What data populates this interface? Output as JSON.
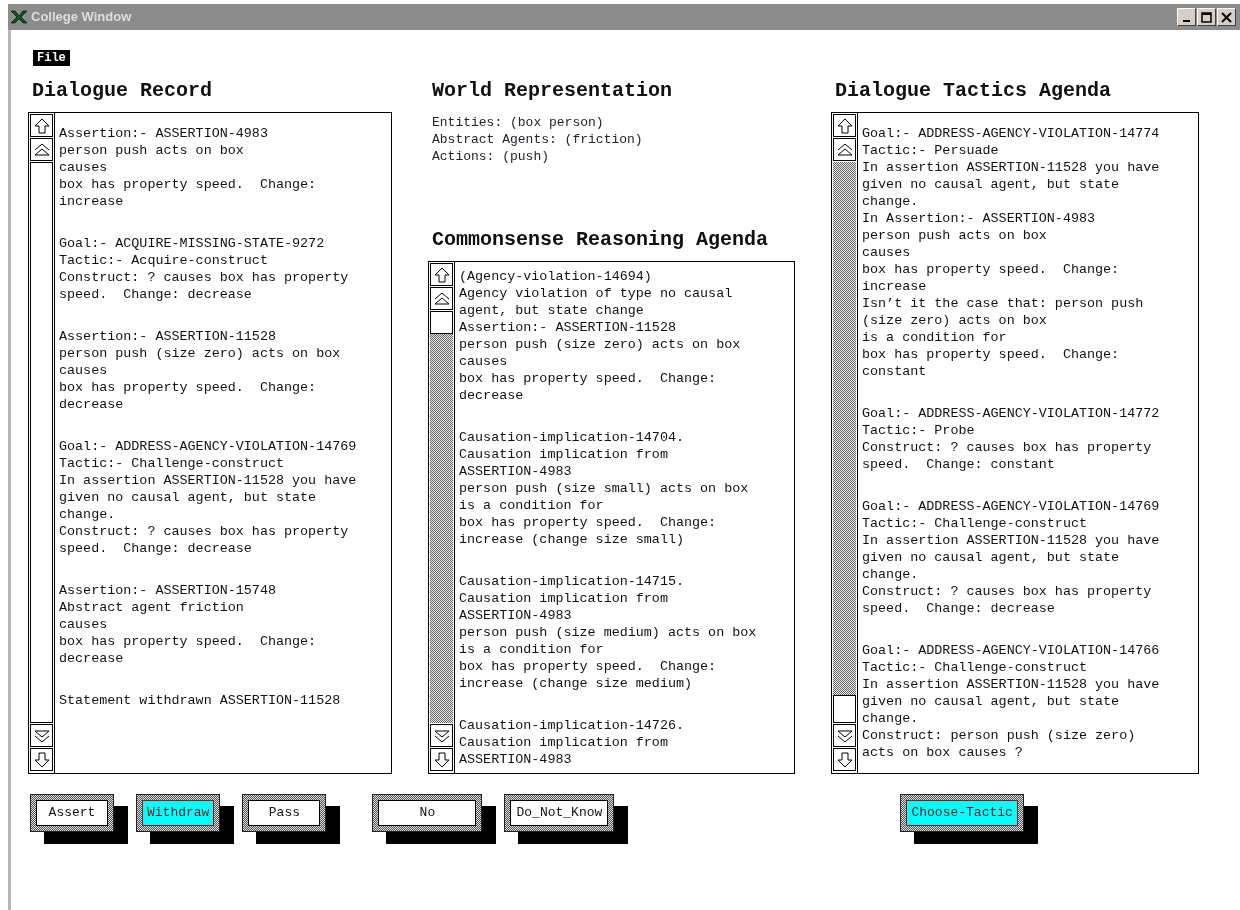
{
  "window": {
    "title": "College Window"
  },
  "menu": [
    {
      "label": "File"
    }
  ],
  "dialogue_record": {
    "heading": "Dialogue Record",
    "entries": [
      [
        "Assertion:- ASSERTION-4983",
        "person push acts on box",
        "causes",
        "box has property speed.  Change:",
        "increase"
      ],
      [
        "Goal:- ACQUIRE-MISSING-STATE-9272",
        "Tactic:- Acquire-construct",
        "Construct: ? causes box has property",
        "speed.  Change: decrease"
      ],
      [
        "Assertion:- ASSERTION-11528",
        "person push (size zero) acts on box",
        "causes",
        "box has property speed.  Change:",
        "decrease"
      ],
      [
        "Goal:- ADDRESS-AGENCY-VIOLATION-14769",
        "Tactic:- Challenge-construct",
        "In assertion ASSERTION-11528 you have",
        "given no causal agent, but state",
        "change.",
        "Construct: ? causes box has property",
        "speed.  Change: decrease"
      ],
      [
        "Assertion:- ASSERTION-15748",
        "Abstract agent friction",
        "causes",
        "box has property speed.  Change:",
        "decrease"
      ],
      [
        "Statement withdrawn ASSERTION-11528"
      ]
    ]
  },
  "world_representation": {
    "heading": "World Representation",
    "lines": [
      "Entities: (box person)",
      "Abstract Agents: (friction)",
      "Actions: (push)"
    ]
  },
  "commonsense_reasoning_agenda": {
    "heading": "Commonsense Reasoning Agenda",
    "entries": [
      [
        "(Agency-violation-14694)",
        "Agency violation of type no causal",
        "agent, but state change",
        "Assertion:- ASSERTION-11528",
        "person push (size zero) acts on box",
        "causes",
        "box has property speed.  Change:",
        "decrease"
      ],
      [
        "Causation-implication-14704.",
        "Causation implication from",
        "ASSERTION-4983",
        "person push (size small) acts on box",
        "is a condition for",
        "box has property speed.  Change:",
        "increase (change size small)"
      ],
      [
        "Causation-implication-14715.",
        "Causation implication from",
        "ASSERTION-4983",
        "person push (size medium) acts on box",
        "is a condition for",
        "box has property speed.  Change:",
        "increase (change size medium)"
      ],
      [
        "Causation-implication-14726.",
        "Causation implication from",
        "ASSERTION-4983"
      ]
    ]
  },
  "dialogue_tactics_agenda": {
    "heading": "Dialogue Tactics Agenda",
    "entries": [
      [
        "Goal:- ADDRESS-AGENCY-VIOLATION-14774",
        "Tactic:- Persuade",
        "In assertion ASSERTION-11528 you have",
        "given no causal agent, but state",
        "change.",
        "In Assertion:- ASSERTION-4983",
        "person push acts on box",
        "causes",
        "box has property speed.  Change:",
        "increase",
        "Isn’t it the case that: person push",
        "(size zero) acts on box",
        "is a condition for",
        "box has property speed.  Change:",
        "constant"
      ],
      [
        "Goal:- ADDRESS-AGENCY-VIOLATION-14772",
        "Tactic:- Probe",
        "Construct: ? causes box has property",
        "speed.  Change: constant"
      ],
      [
        "Goal:- ADDRESS-AGENCY-VIOLATION-14769",
        "Tactic:- Challenge-construct",
        "In assertion ASSERTION-11528 you have",
        "given no causal agent, but state",
        "change.",
        "Construct: ? causes box has property",
        "speed.  Change: decrease"
      ],
      [
        "Goal:- ADDRESS-AGENCY-VIOLATION-14766",
        "Tactic:- Challenge-construct",
        "In assertion ASSERTION-11528 you have",
        "given no causal agent, but state",
        "change.",
        "Construct: person push (size zero)",
        "acts on box causes ?"
      ]
    ]
  },
  "dialogue_buttons": [
    [
      {
        "label": "Assert",
        "selected": false
      },
      {
        "label": "Withdraw",
        "selected": true
      },
      {
        "label": "Pass",
        "selected": false
      }
    ],
    [
      {
        "label": "No",
        "selected": false
      },
      {
        "label": "Do_Not_Know",
        "selected": false
      }
    ]
  ],
  "tactic_buttons": [
    {
      "label": "Choose-Tactic",
      "selected": true
    }
  ]
}
